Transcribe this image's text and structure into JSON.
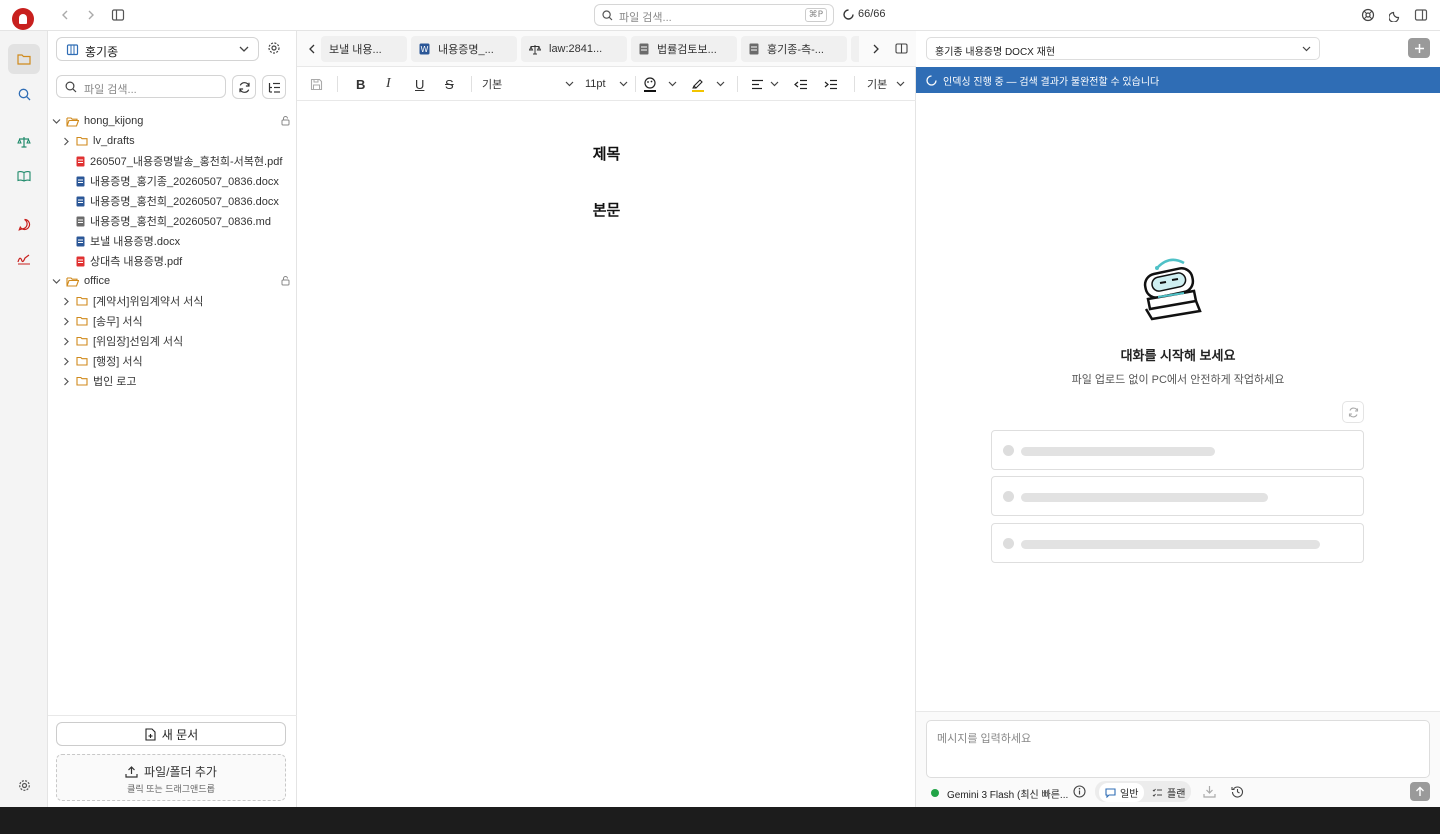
{
  "topbar": {
    "search_placeholder": "파일 검색...",
    "search_shortcut": "⌘P",
    "progress": "66/66"
  },
  "sidebar": {
    "workspace": "홍기종",
    "search_placeholder": "파일 검색...",
    "tree": [
      {
        "label": "hong_kijong",
        "type": "folder-open",
        "depth": 0,
        "locked": true
      },
      {
        "label": "lv_drafts",
        "type": "folder",
        "depth": 1
      },
      {
        "label": "260507_내용증명발송_홍천희-서복현.pdf",
        "type": "pdf",
        "depth": 1
      },
      {
        "label": "내용증명_홍기종_20260507_0836.docx",
        "type": "docx",
        "depth": 1
      },
      {
        "label": "내용증명_홍천희_20260507_0836.docx",
        "type": "docx",
        "depth": 1
      },
      {
        "label": "내용증명_홍천희_20260507_0836.md",
        "type": "md",
        "depth": 1
      },
      {
        "label": "보낼 내용증명.docx",
        "type": "docx",
        "depth": 1
      },
      {
        "label": "상대측 내용증명.pdf",
        "type": "pdf",
        "depth": 1
      },
      {
        "label": "office",
        "type": "folder-open",
        "depth": 0,
        "locked": true
      },
      {
        "label": "[계약서]위임계약서 서식",
        "type": "folder",
        "depth": 1
      },
      {
        "label": "[송무] 서식",
        "type": "folder",
        "depth": 1
      },
      {
        "label": "[위임장]선임계 서식",
        "type": "folder",
        "depth": 1
      },
      {
        "label": "[행정] 서식",
        "type": "folder",
        "depth": 1
      },
      {
        "label": "법인 로고",
        "type": "folder",
        "depth": 1
      }
    ],
    "new_doc": "새 문서",
    "add_files": "파일/폴더 추가",
    "add_hint": "클릭 또는 드래그앤드롭"
  },
  "editor": {
    "tabs": [
      {
        "label": "보낼 내용...",
        "icon": "none"
      },
      {
        "label": "내용증명_...",
        "icon": "docx"
      },
      {
        "label": "law:2841...",
        "icon": "scale"
      },
      {
        "label": "법률검토보...",
        "icon": "doc"
      },
      {
        "label": "홍기종-측-...",
        "icon": "doc"
      }
    ],
    "toolbar": {
      "paragraph_style": "기본",
      "font_size": "11pt",
      "line_style": "기본"
    },
    "doc": {
      "title": "제목",
      "body": "본문"
    }
  },
  "chat": {
    "thread": "홍기종 내용증명 DOCX 재현",
    "banner": "인덱싱 진행 중 — 검색 결과가 불완전할 수 있습니다",
    "hero_title": "대화를 시작해 보세요",
    "hero_sub": "파일 업로드 없이 PC에서 안전하게 작업하세요",
    "input_placeholder": "메시지를 입력하세요",
    "model": "Gemini 3 Flash (최신 빠른...",
    "mode_general": "일반",
    "mode_plan": "플랜"
  },
  "colors": {
    "accent": "#2f6db5",
    "brand": "#c8201e",
    "model_status": "#22a447"
  }
}
